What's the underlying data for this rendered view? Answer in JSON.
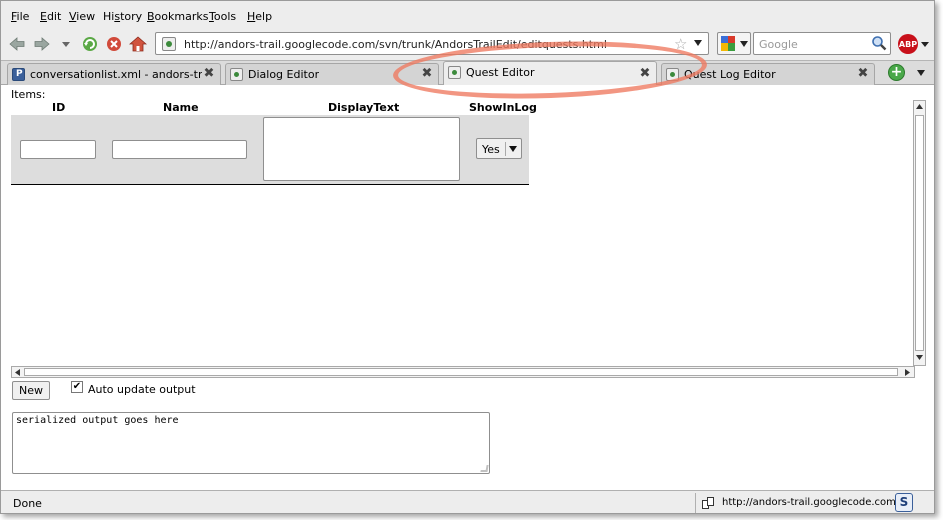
{
  "menu": {
    "file": {
      "accel": "F",
      "rest": "ile"
    },
    "edit": {
      "accel": "E",
      "rest": "dit"
    },
    "view": {
      "accel": "V",
      "rest": "iew"
    },
    "history": {
      "pre": "Hi",
      "accel": "s",
      "rest": "tory"
    },
    "bookmarks": {
      "accel": "B",
      "rest": "ookmarks"
    },
    "tools": {
      "accel": "T",
      "rest": "ools"
    },
    "help": {
      "accel": "H",
      "rest": "elp"
    }
  },
  "nav": {
    "url": "http://andors-trail.googlecode.com/svn/trunk/AndorsTrailEdit/editquests.html",
    "search_placeholder": "Google",
    "abp_label": "ABP"
  },
  "tabs": [
    {
      "label": "conversationlist.xml - andors-trail -..."
    },
    {
      "label": "Dialog Editor"
    },
    {
      "label": "Quest Editor"
    },
    {
      "label": "Quest Log Editor"
    }
  ],
  "editor": {
    "items_label": "Items:",
    "columns": {
      "id": "ID",
      "name": "Name",
      "display_text": "DisplayText",
      "show_in_log": "ShowInLog"
    },
    "row": {
      "id_value": "",
      "name_value": "",
      "display_text_value": "",
      "show_in_log_value": "Yes"
    },
    "new_button": "New",
    "auto_update_label": "Auto update output",
    "auto_update_checked": true,
    "output_text": "serialized output goes here"
  },
  "status": {
    "text": "Done",
    "link": "http://andors-trail.googlecode.com/",
    "badge": "S"
  },
  "colors": {
    "highlight": "#ee785f",
    "abp": "#c8101a"
  }
}
